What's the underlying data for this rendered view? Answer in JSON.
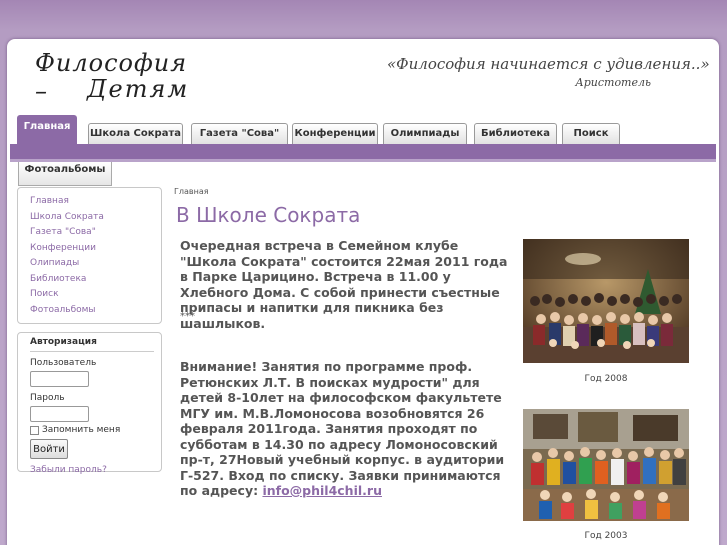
{
  "header": {
    "logo_line1": "Философия –",
    "logo_line2": "Детям",
    "quote": "«Философия начинается с удивления..»",
    "quote_author": "Аристотель"
  },
  "nav": {
    "tabs": [
      "Главная",
      "Школа Сократа",
      "Газета \"Сова\"",
      "Конференции",
      "Олимпиады",
      "Библиотека",
      "Поиск"
    ],
    "second_row_tab": "Фотоальбомы"
  },
  "sidebar": {
    "items": [
      "Главная",
      "Школа Сократа",
      "Газета \"Сова\"",
      "Конференции",
      "Олипиады",
      "Библиотека",
      "Поиск",
      "Фотоальбомы"
    ]
  },
  "auth": {
    "title": "Авторизация",
    "user_label": "Пользователь",
    "password_label": "Пароль",
    "remember_label": "Запомнить меня",
    "login_button": "Войти",
    "forgot_link": "Забыли пароль?"
  },
  "main": {
    "breadcrumb": "Главная",
    "title": "В Школе Сократа",
    "paragraph1": "Очередная встреча в Семейном клубе \"Школа Сократа\" состоится 22мая  2011 года  в Парке Царицино. Встреча в 11.00 у Хлебного Дома. С собой принести съестные припасы и напитки для пикника без шашлыков.",
    "separator": "***",
    "paragraph2": "Внимание! Занятия по программе проф. Ретюнских Л.Т.   В поисках мудрости\" для детей  8-10лет на философском факультете МГУ им. М.В.Ломоносова возобновятся   26 февраля   2011года. Занятия проходят по субботам в 14.30 по адресу Ломоносовский пр-т,  27Новый учебный корпус. в аудитории   Г-527. Вход по списку. Заявки принимаются по адресу: ",
    "email": "info@phil4chil.ru"
  },
  "photos": [
    {
      "caption": "Год 2008"
    },
    {
      "caption": "Год 2003"
    }
  ],
  "colors": {
    "accent": "#8c6aa6",
    "background": "#b9a1c8"
  }
}
